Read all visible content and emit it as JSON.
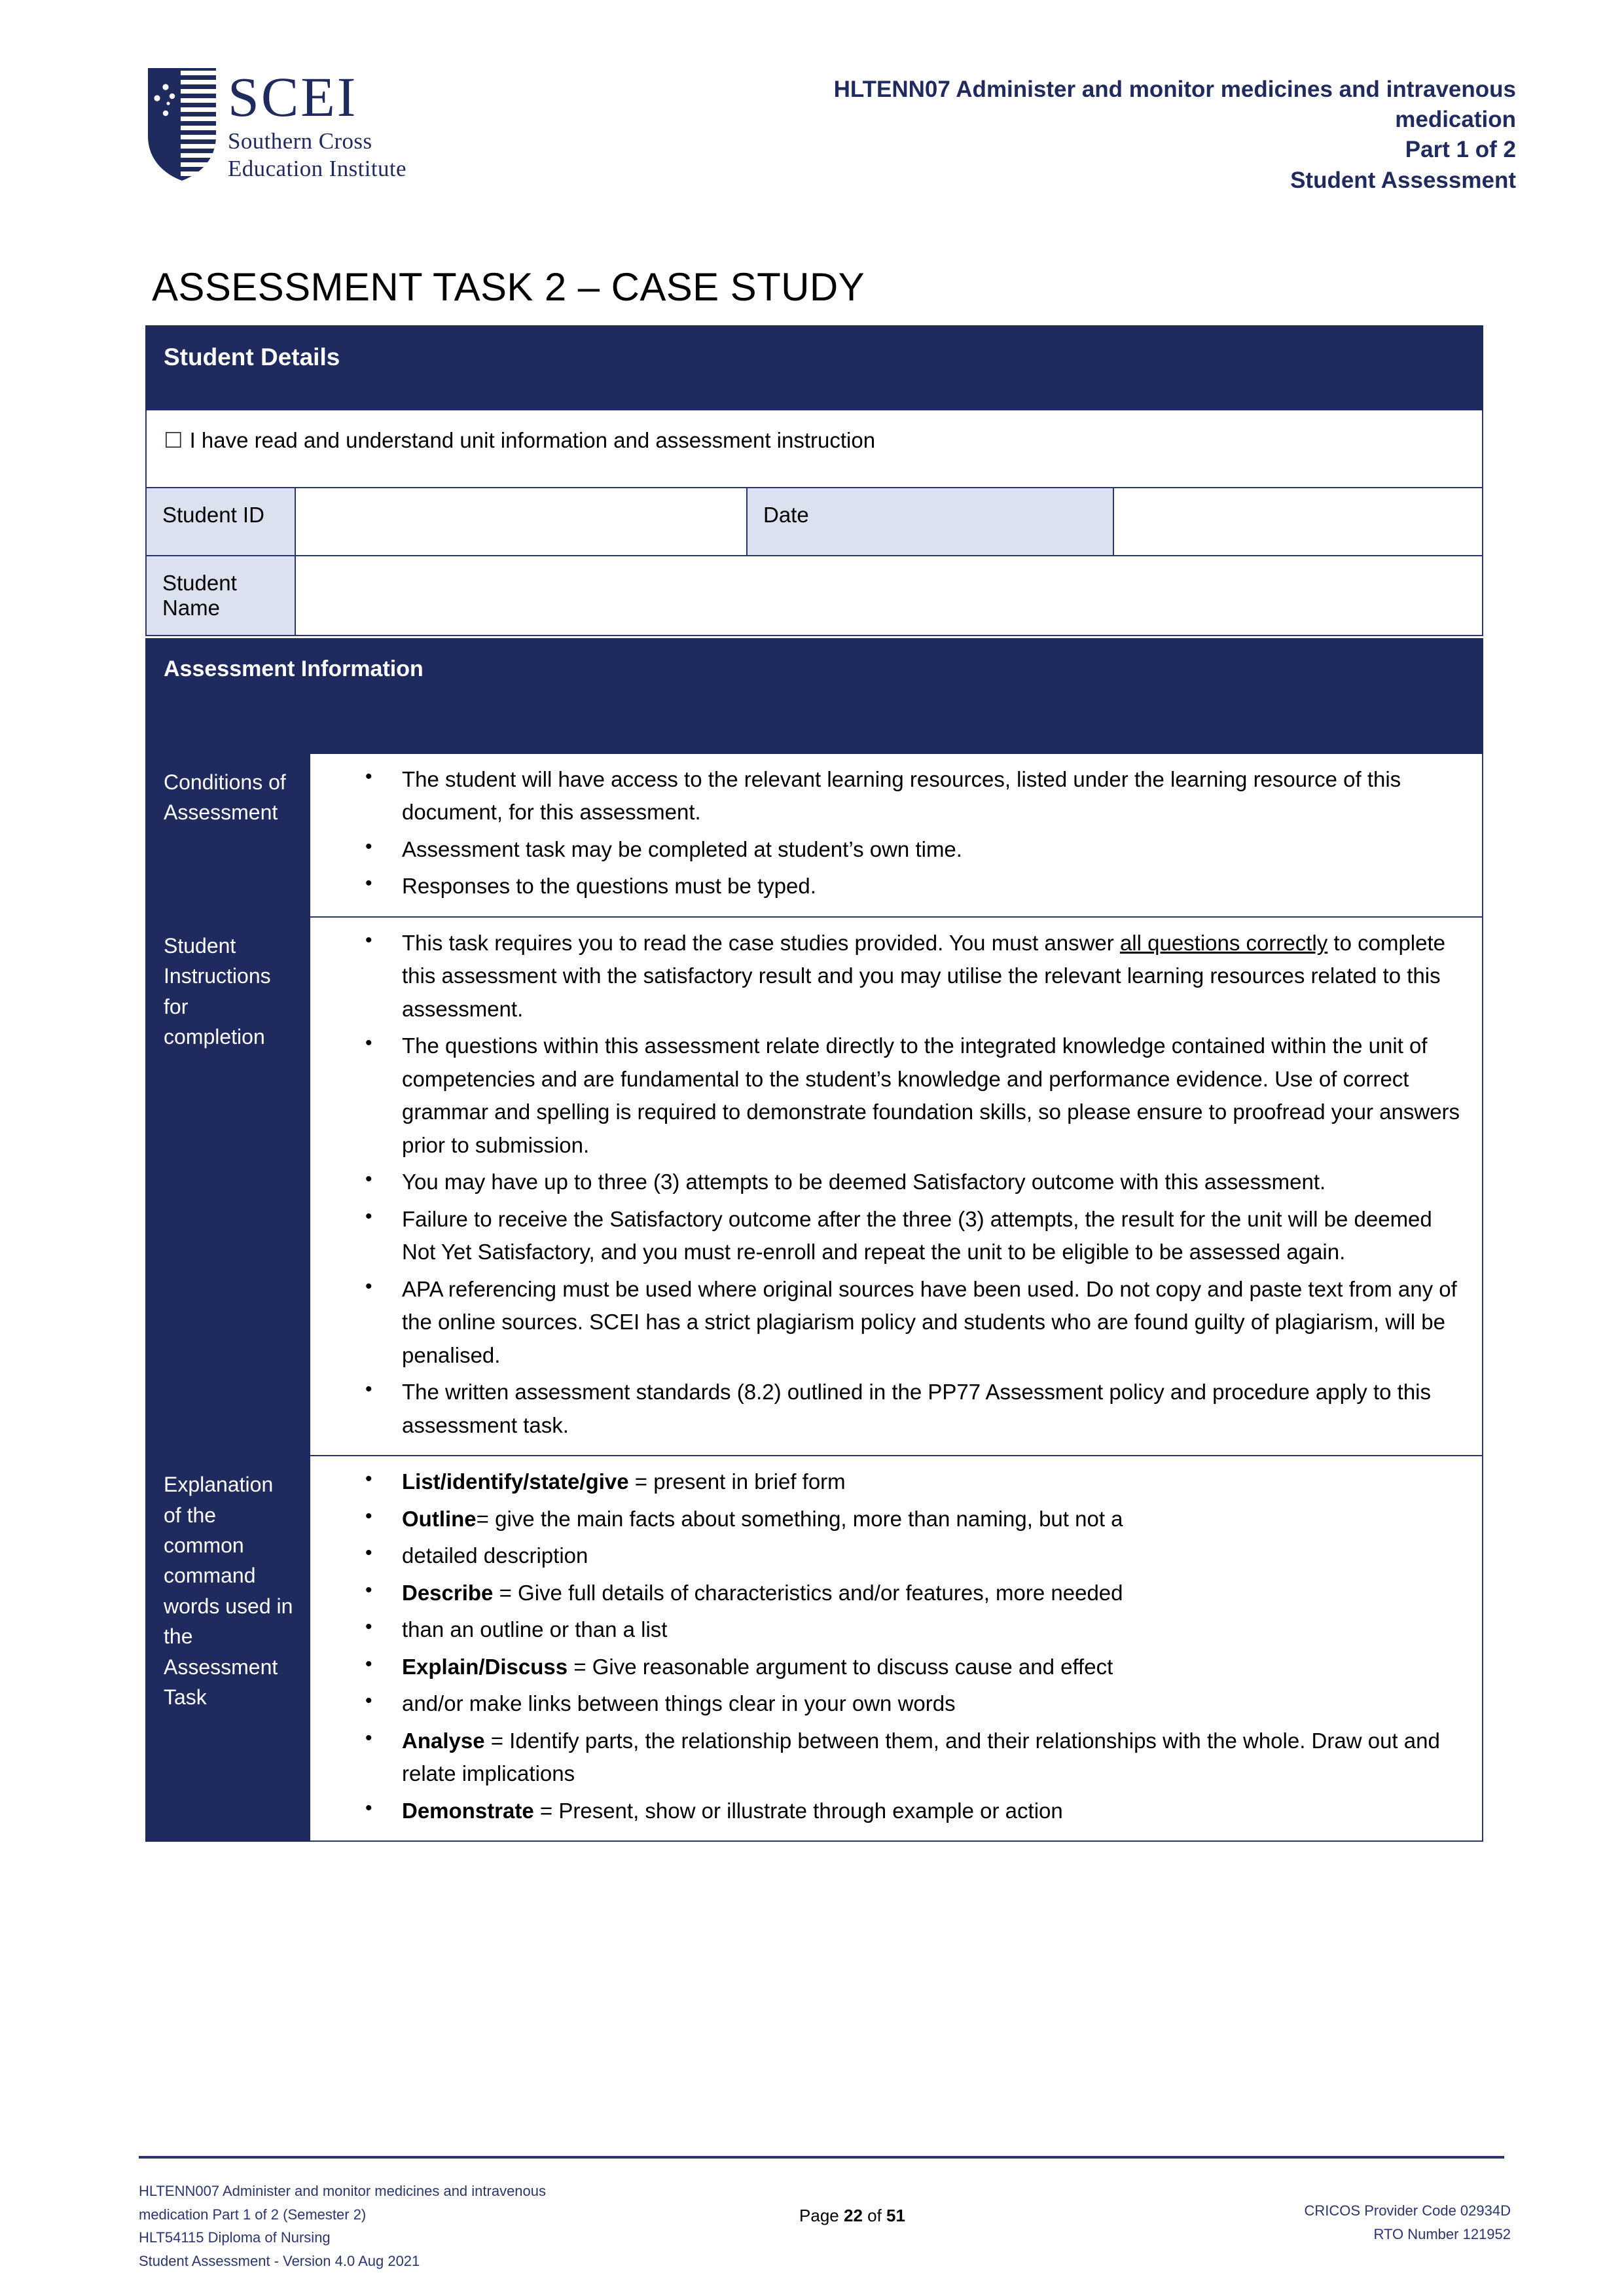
{
  "header": {
    "logo": {
      "acronym": "SCEI",
      "line1": "Southern Cross",
      "line2": "Education Institute",
      "shield_icon": "scei-shield-logo"
    },
    "title_lines": [
      "HLTENN07 Administer and monitor medicines and intravenous",
      "medication",
      "Part 1 of 2",
      "Student Assessment"
    ]
  },
  "main_title": "ASSESSMENT TASK 2 – CASE STUDY",
  "student_details": {
    "section_title": "Student Details",
    "declaration_checkbox": "☐",
    "declaration_text": "I have read and understand unit information and assessment instruction",
    "student_id_label": "Student ID",
    "student_id_value": "",
    "date_label": "Date",
    "date_value": "",
    "student_name_label": "Student Name",
    "student_name_value": ""
  },
  "assessment_information": {
    "section_title": "Assessment Information",
    "rows": [
      {
        "label": "Conditions of Assessment",
        "bullets": [
          {
            "text": "The student will have access to the relevant learning resources, listed under the learning resource of this document, for this assessment."
          },
          {
            "text": "Assessment task may be completed at student’s own time."
          },
          {
            "text": "Responses to the questions must be typed."
          }
        ]
      },
      {
        "label": "Student Instructions for completion",
        "bullets": [
          {
            "pre": "This task requires you to read the case studies provided. You must answer ",
            "underline": "all questions correctly",
            "post": " to complete this assessment with the satisfactory result and you may utilise the relevant learning resources related to this assessment."
          },
          {
            "text": "The questions within this assessment relate directly to the integrated knowledge contained within the unit of competencies and are fundamental to the student’s knowledge and performance evidence. Use of correct grammar and spelling is required to demonstrate foundation skills, so please ensure to proofread your answers prior to submission."
          },
          {
            "text": "You may have up to three (3) attempts to be deemed Satisfactory outcome with this assessment."
          },
          {
            "text": "Failure to receive the Satisfactory outcome after the three (3) attempts, the result for the unit will be deemed Not Yet Satisfactory, and you must re-enroll and repeat the unit to be eligible to be assessed again."
          },
          {
            "text": "APA referencing must be used where original sources have been used.  Do not copy and paste text from any of the online sources. SCEI has a strict plagiarism policy and students who are found guilty of plagiarism, will be penalised."
          },
          {
            "text": "The written assessment standards (8.2) outlined in the PP77 Assessment policy and procedure apply to this assessment task."
          }
        ]
      },
      {
        "label": "Explanation of the common command words used in the Assessment Task",
        "bullets": [
          {
            "bold": "List/identify/state/give",
            "post": " = present in brief form"
          },
          {
            "bold": "Outline",
            "post": "= give the main facts about something, more than naming, but not a"
          },
          {
            "text": "detailed description"
          },
          {
            "bold": "Describe",
            "post": " = Give full details of characteristics and/or features, more needed"
          },
          {
            "text": "than an outline or than a list"
          },
          {
            "bold": "Explain/Discuss",
            "post": " = Give reasonable argument to discuss cause and effect"
          },
          {
            "text": "and/or make links between things clear in your own words"
          },
          {
            "bold": "Analyse",
            "post": " = Identify parts, the relationship between them, and their relationships with the whole. Draw out and relate implications"
          },
          {
            "bold": "Demonstrate",
            "post": " = Present, show or illustrate through example or action"
          }
        ]
      }
    ]
  },
  "footer": {
    "left_lines": [
      "HLTENN007 Administer and monitor medicines and intravenous",
      "medication Part 1 of 2 (Semester 2)",
      "HLT54115 Diploma of Nursing",
      "Student Assessment -  Version 4.0 Aug 2021"
    ],
    "page_prefix": "Page ",
    "page_number": "22",
    "page_middle": " of ",
    "page_total": "51",
    "right_lines": [
      "CRICOS Provider Code 02934D",
      "RTO Number 121952"
    ]
  },
  "colors": {
    "navy": "#1F2A5E",
    "border_navy": "#2A3570",
    "light_blue": "#DCE1F0"
  }
}
